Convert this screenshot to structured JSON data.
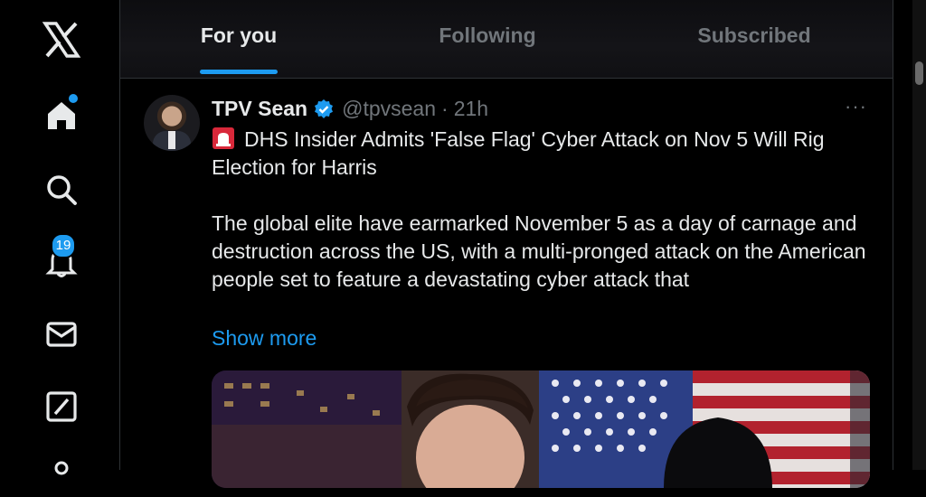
{
  "sidebar": {
    "items": [
      {
        "name": "x-logo-icon"
      },
      {
        "name": "home-icon",
        "has_dot": true
      },
      {
        "name": "search-icon"
      },
      {
        "name": "notifications-icon",
        "badge": "19"
      },
      {
        "name": "messages-icon"
      },
      {
        "name": "grok-icon"
      },
      {
        "name": "profile-icon"
      }
    ]
  },
  "tabs": [
    {
      "label": "For you",
      "active": true
    },
    {
      "label": "Following",
      "active": false
    },
    {
      "label": "Subscribed",
      "active": false
    }
  ],
  "post": {
    "display_name": "TPV Sean",
    "handle": "@tpvsean",
    "separator": "·",
    "time": "21h",
    "more_label": "···",
    "headline": "DHS Insider Admits 'False Flag' Cyber Attack on Nov 5 Will Rig Election for Harris",
    "body": "The global elite have earmarked November 5 as a day of carnage and destruction across the US, with a multi-pronged attack on the American people set to feature a devastating cyber attack that",
    "show_more": "Show more"
  },
  "colors": {
    "accent": "#1d9bf0",
    "text": "#e7e9ea",
    "muted": "#71767b",
    "border": "#2f3336"
  }
}
